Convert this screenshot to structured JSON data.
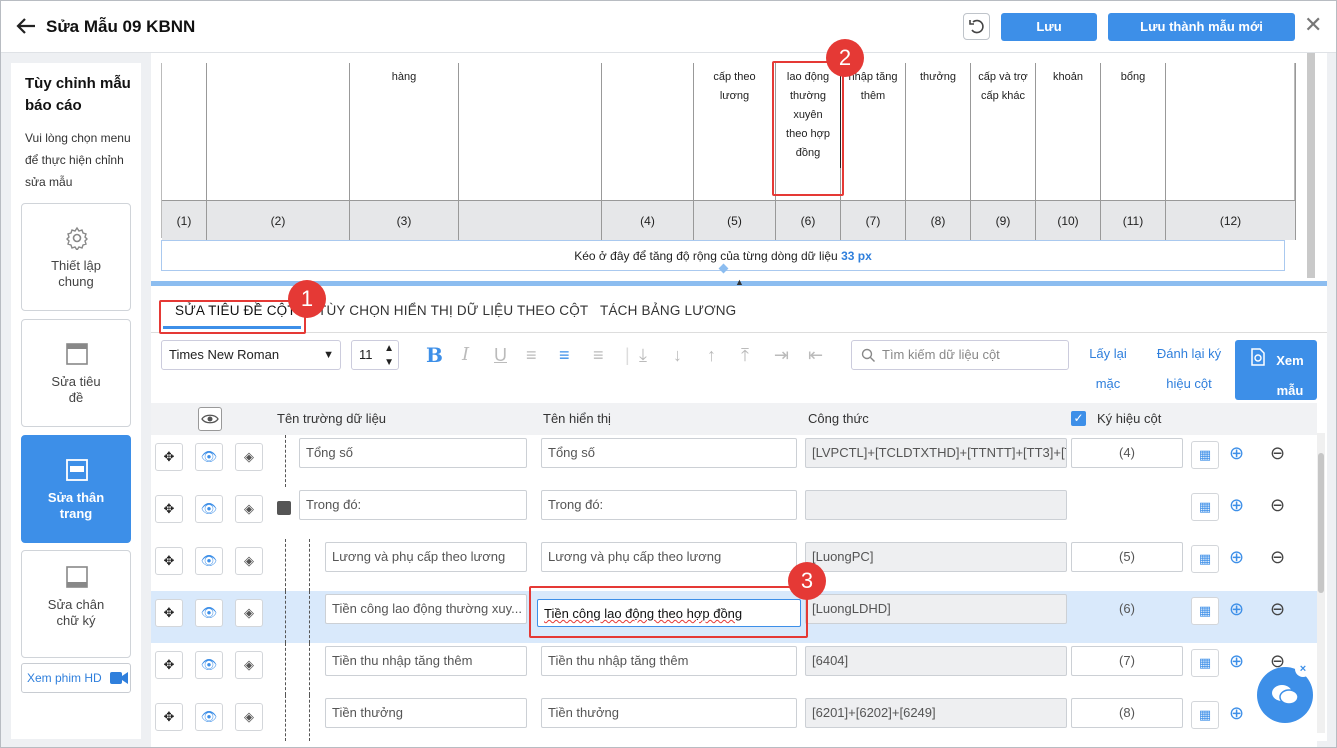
{
  "header": {
    "title": "Sửa Mẫu 09 KBNN",
    "save_label": "Lưu",
    "save_new_label": "Lưu thành mẫu mới"
  },
  "sidebar": {
    "heading": "Tùy chỉnh mẫu báo cáo",
    "description": "Vui lòng chọn menu để thực hiện chỉnh sửa mẫu",
    "items": [
      {
        "label": "Thiết lập chung",
        "icon": "gear-icon"
      },
      {
        "label": "Sửa tiêu đề",
        "icon": "header-layout-icon"
      },
      {
        "label": "Sửa thân trang",
        "icon": "body-layout-icon"
      },
      {
        "label": "Sửa chân chữ ký",
        "icon": "footer-layout-icon"
      }
    ],
    "video_label": "Xem phim HD"
  },
  "preview": {
    "headers": [
      "",
      "",
      "hàng",
      "",
      "",
      "cấp theo lương",
      "lao động thường xuyên theo hợp đồng",
      "nhập tăng thêm",
      "thưởng",
      "cấp và trợ cấp khác",
      "khoản",
      "bổng",
      ""
    ],
    "numbers": [
      "(1)",
      "(2)",
      "(3)",
      "",
      "(4)",
      "(5)",
      "(6)",
      "(7)",
      "(8)",
      "(9)",
      "(10)",
      "(11)",
      "(12)"
    ],
    "drag_text": "Kéo ở đây để tăng độ rộng của từng dòng dữ liệu",
    "drag_value": "33 px"
  },
  "tabs": [
    {
      "label": "SỬA TIÊU ĐỀ CỘT"
    },
    {
      "label": "TÙY CHỌN HIỂN THỊ DỮ LIỆU THEO CỘT"
    },
    {
      "label": "TÁCH BẢNG LƯƠNG"
    }
  ],
  "toolbar": {
    "font": "Times New Roman",
    "size": "11",
    "search_placeholder": "Tìm kiếm dữ liệu cột",
    "reset_default": "Lấy lại mặc định",
    "renumber": "Đánh lại ký hiệu cột",
    "view_label": "Xem mẫu"
  },
  "table": {
    "columns": {
      "field": "Tên trường dữ liệu",
      "display": "Tên hiển thị",
      "formula": "Công thức",
      "symbol": "Ký hiệu cột"
    },
    "rows": [
      {
        "field": "Tổng số",
        "display": "Tổng số",
        "formula": "[LVPCTL]+[TCLDTXTHD]+[TTNTT]+[TT3]+[TI",
        "symbol": "(4)"
      },
      {
        "field": "Trong đó:",
        "display": "Trong đó:",
        "formula": "",
        "symbol": ""
      },
      {
        "field": "Lương và phụ cấp theo lương",
        "display": "Lương và phụ cấp theo lương",
        "formula": "[LuongPC]",
        "symbol": "(5)"
      },
      {
        "field": "Tiền công lao động thường xuy...",
        "display": "Tiền công lao động theo hợp đồng",
        "formula": "[LuongLDHD]",
        "symbol": "(6)"
      },
      {
        "field": "Tiền thu nhập tăng thêm",
        "display": "Tiền thu nhập tăng thêm",
        "formula": "[6404]",
        "symbol": "(7)"
      },
      {
        "field": "Tiền thưởng",
        "display": "Tiền thưởng",
        "formula": "[6201]+[6202]+[6249]",
        "symbol": "(8)"
      }
    ]
  },
  "callouts": [
    "1",
    "2",
    "3"
  ],
  "colors": {
    "accent": "#3d8fe8",
    "highlight": "#e53935",
    "selected_row": "#d9e9fb"
  }
}
